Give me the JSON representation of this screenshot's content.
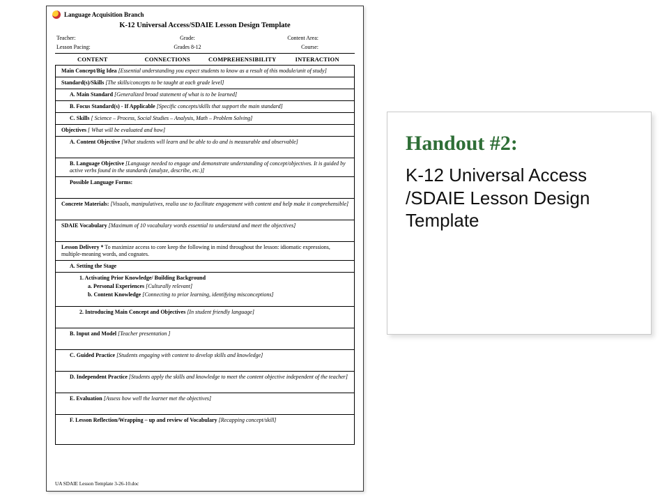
{
  "caption": {
    "title": "Handout #2:",
    "desc": "K-12 Universal Access /SDAIE Lesson Design Template"
  },
  "form": {
    "brand": "Language Acquisition Branch",
    "title": "K-12 Universal Access/SDAIE Lesson Design Template",
    "meta": {
      "teacher_label": "Teacher:",
      "grade_label": "Grade:",
      "content_area_label": "Content Area:",
      "pacing_label": "Lesson Pacing:",
      "grades_value": "Grades 8-12",
      "course_label": "Course:"
    },
    "columns": {
      "c1": "CONTENT",
      "c2": "CONNECTIONS",
      "c3": "COMPREHENSIBILITY",
      "c4": "INTERACTION"
    },
    "rows": {
      "main_concept": {
        "label": "Main Concept/Big Idea",
        "hint": "[Essential understanding you expect students to know as a result of this module/unit of study]"
      },
      "standards": {
        "label": "Standard(s)/Skills",
        "hint": "[The skills/concepts to be taught at each grade level]"
      },
      "main_standard": {
        "label": "A. Main Standard",
        "hint": "[Generalized broad statement of what is to be learned]"
      },
      "focus_standard": {
        "label": "B. Focus Standard(s) - If Applicable",
        "hint": "[Specific concepts/skills that support the main standard]"
      },
      "skills": {
        "label": "C. Skills",
        "hint": "[ Science – Process, Social Studies – Analysis, Math – Problem Solving]"
      },
      "objectives": {
        "label": "Objectives",
        "hint": "[ What will be evaluated and how]"
      },
      "content_obj": {
        "label": "A. Content Objective",
        "hint": "[What students will learn and be able to do and is measurable and observable]"
      },
      "lang_obj": {
        "label": "B. Language Objective",
        "hint": "[Language needed to engage and demonstrate understanding of concept/objectives. It is guided by active verbs found in the standards (analyze, describe, etc.)]"
      },
      "lang_forms": {
        "label": "Possible Language Forms:"
      },
      "materials": {
        "label": "Concrete Materials:",
        "hint": "[Visuals, manipulatives, realia use to facilitate engagement with content and help make it comprehensible]"
      },
      "vocab": {
        "label": "SDAIE Vocabulary",
        "hint": "[Maximum of 10 vocabulary words essential to understand and meet the objectives]"
      },
      "delivery": {
        "label": "Lesson Delivery *",
        "hint": "To maximize access to core keep the following in mind throughout the lesson: idiomatic expressions, multiple-meaning words, and cognates."
      },
      "setting": {
        "label": "A. Setting the Stage"
      },
      "activating": {
        "label": "1. Activating Prior Knowledge/ Building Background",
        "a_label": "a. Personal Experiences",
        "a_hint": "[Culturally relevant]",
        "b_label": "b. Content Knowledge",
        "b_hint": "[Connecting to prior learning, identifying misconceptions]"
      },
      "introducing": {
        "label": "2. Introducing Main Concept and Objectives",
        "hint": "[In student friendly language]"
      },
      "input": {
        "label": "B. Input and Model",
        "hint": "[Teacher presentation ]"
      },
      "guided": {
        "label": "C. Guided Practice",
        "hint": "[Students engaging with content to develop skills and knowledge]"
      },
      "independent": {
        "label": "D. Independent Practice",
        "hint": "[Students apply the skills and knowledge to meet the content objective independent of the teacher]"
      },
      "evaluation": {
        "label": "E. Evaluation",
        "hint": "[Assess how well the learner met the objectives]"
      },
      "reflection": {
        "label": "F. Lesson Reflection/Wrapping – up and review of Vocabulary",
        "hint": "[Recapping concept/skill]"
      }
    },
    "footer": "UA SDAIE Lesson Template 3-26-10.doc"
  }
}
